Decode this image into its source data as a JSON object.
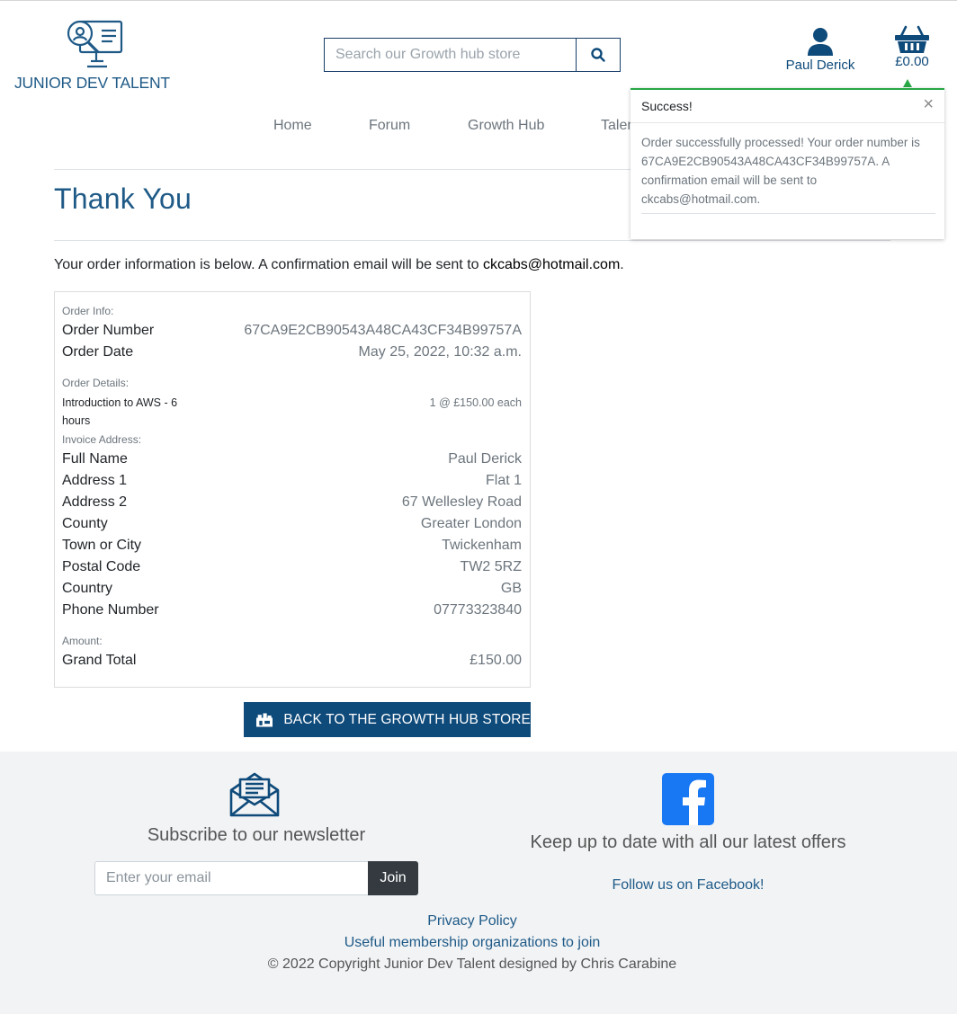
{
  "brand": {
    "name": "JUNIOR DEV TALENT",
    "icon": "monitor-magnifier-logo"
  },
  "search": {
    "placeholder": "Search our Growth hub store",
    "icon": "search-icon"
  },
  "account": {
    "name": "Paul Derick",
    "icon": "user-icon"
  },
  "cart": {
    "total": "£0.00",
    "icon": "basket-icon"
  },
  "nav": {
    "items": [
      "Home",
      "Forum",
      "Growth Hub",
      "Talent"
    ]
  },
  "toast": {
    "title": "Success!",
    "close": "×",
    "message": "Order successfully processed! Your order number is 67CA9E2CB90543A48CA43CF34B99757A. A confirmation email will be sent to ckcabs@hotmail.com.",
    "accent_color": "#28a745"
  },
  "page": {
    "title": "Thank You",
    "intro_text": "Your order information is below. A confirmation email will be sent to ",
    "intro_email": "ckcabs@hotmail.com",
    "intro_end": "."
  },
  "order": {
    "info_heading": "Order Info:",
    "number_label": "Order Number",
    "number": "67CA9E2CB90543A48CA43CF34B99757A",
    "date_label": "Order Date",
    "date": "May 25, 2022, 10:32 a.m.",
    "details_heading": "Order Details:",
    "product_name": "Introduction to AWS - 6 hours",
    "product_qty": "1 @ £150.00 each",
    "invoice_heading": "Invoice Address:",
    "address": [
      {
        "label": "Full Name",
        "value": "Paul Derick"
      },
      {
        "label": "Address 1",
        "value": "Flat 1"
      },
      {
        "label": "Address 2",
        "value": "67 Wellesley Road"
      },
      {
        "label": "County",
        "value": "Greater London"
      },
      {
        "label": "Town or City",
        "value": "Twickenham"
      },
      {
        "label": "Postal Code",
        "value": "TW2 5RZ"
      },
      {
        "label": "Country",
        "value": "GB"
      },
      {
        "label": "Phone Number",
        "value": "07773323840"
      }
    ],
    "amount_heading": "Amount:",
    "total_label": "Grand Total",
    "total": "£150.00"
  },
  "back_button": {
    "label": "BACK TO THE GROWTH HUB STORE",
    "icon": "shop-icon"
  },
  "footer": {
    "newsletter_title": "Subscribe to our newsletter",
    "email_placeholder": "Enter your email",
    "join_label": "Join",
    "newsletter_icon": "envelope-open-icon",
    "fb_title": "Keep up to date with all our latest offers",
    "fb_link": "Follow us on Facebook!",
    "fb_icon": "facebook-icon",
    "privacy": "Privacy Policy",
    "memberships": "Useful membership organizations to join",
    "copyright": "© 2022 Copyright Junior Dev Talent designed by Chris Carabine"
  },
  "colors": {
    "brand_blue": "#0e4a7a",
    "link_blue": "#1f5a87",
    "success_green": "#28a745",
    "facebook_blue": "#1877f2"
  }
}
